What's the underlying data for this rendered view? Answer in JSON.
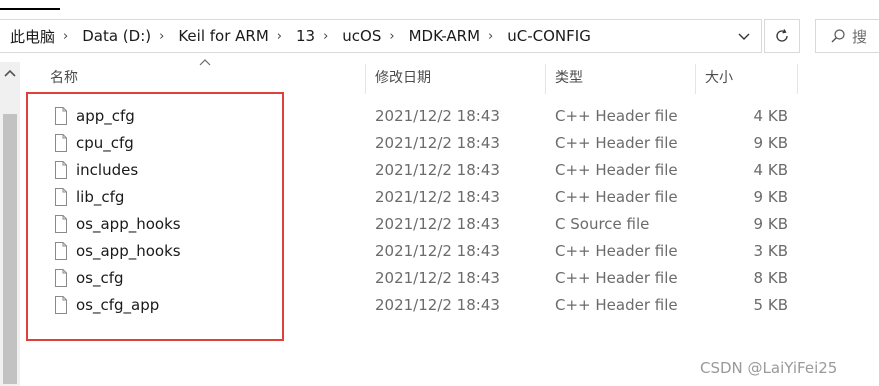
{
  "breadcrumb": [
    "此电脑",
    "Data (D:)",
    "Keil for ARM",
    "13",
    "ucOS",
    "MDK-ARM",
    "uC-CONFIG"
  ],
  "search": {
    "placeholder": "搜"
  },
  "columns": {
    "name": "名称",
    "date": "修改日期",
    "type": "类型",
    "size": "大小"
  },
  "files": [
    {
      "name": "app_cfg",
      "date": "2021/12/2 18:43",
      "type": "C++ Header file",
      "size": "4 KB"
    },
    {
      "name": "cpu_cfg",
      "date": "2021/12/2 18:43",
      "type": "C++ Header file",
      "size": "9 KB"
    },
    {
      "name": "includes",
      "date": "2021/12/2 18:43",
      "type": "C++ Header file",
      "size": "4 KB"
    },
    {
      "name": "lib_cfg",
      "date": "2021/12/2 18:43",
      "type": "C++ Header file",
      "size": "9 KB"
    },
    {
      "name": "os_app_hooks",
      "date": "2021/12/2 18:43",
      "type": "C Source file",
      "size": "9 KB"
    },
    {
      "name": "os_app_hooks",
      "date": "2021/12/2 18:43",
      "type": "C++ Header file",
      "size": "3 KB"
    },
    {
      "name": "os_cfg",
      "date": "2021/12/2 18:43",
      "type": "C++ Header file",
      "size": "8 KB"
    },
    {
      "name": "os_cfg_app",
      "date": "2021/12/2 18:43",
      "type": "C++ Header file",
      "size": "5 KB"
    }
  ],
  "watermark": "CSDN @LaiYiFei25",
  "colors": {
    "highlight_border": "#e0403a",
    "header_text": "#4d4d4d",
    "secondary_text": "#6b6b6b"
  },
  "icons": {
    "file": "file-icon",
    "refresh": "refresh-icon",
    "search": "search-icon",
    "dropdown": "chevron-down-icon",
    "sort": "sort-ascending-icon"
  }
}
